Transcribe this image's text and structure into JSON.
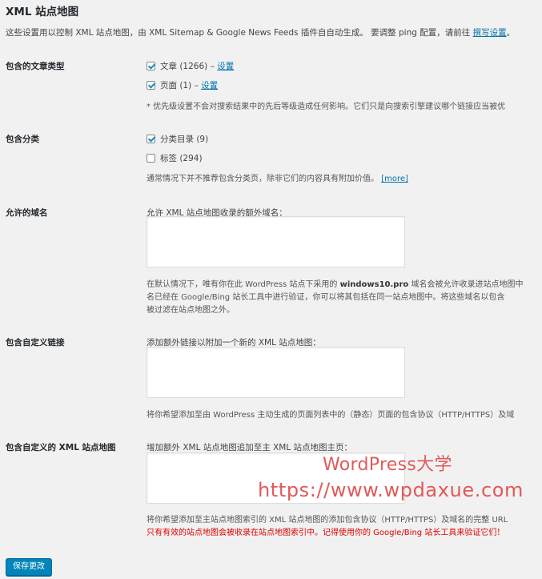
{
  "title": "XML 站点地图",
  "intro": {
    "text": "这些设置用以控制 XML 站点地图，由 XML Sitemap & Google News Feeds 插件自自动生成。 要调整 ping 配置，请前往",
    "link": "撰写设置",
    "end": "。"
  },
  "post_types": {
    "label": "包含的文章类型",
    "items": [
      {
        "label": "文章 (1266)",
        "sep": "–",
        "link": "设置",
        "checked": true
      },
      {
        "label": "页面 (1)",
        "sep": "–",
        "link": "设置",
        "checked": true
      }
    ],
    "note": "* 优先级设置不会对搜索结果中的先后等级造成任何影响。它们只是向搜索引擎建议哪个链接应当被优"
  },
  "taxonomies": {
    "label": "包含分类",
    "items": [
      {
        "label": "分类目录 (9)",
        "checked": true
      },
      {
        "label": "标签 (294)",
        "checked": false
      }
    ],
    "note": "通常情况下并不推荐包含分类页，除非它们的内容具有附加价值。",
    "more": "[more]"
  },
  "domains": {
    "label": "允许的域名",
    "field_label": "允许 XML 站点地图收录的额外域名：",
    "note_l1_a": "在默认情况下，唯有你在此 WordPress 站点下采用的",
    "note_l1_b": "windows10.pro",
    "note_l1_c": "域名会被允许收录进站点地图中",
    "note_l2": "名已经在 Google/Bing 站长工具中进行验证，你可以将其包括在同一站点地图中。将这些域名以包含",
    "note_l3": "被过滤在站点地图之外。"
  },
  "custom_urls": {
    "label": "包含自定义链接",
    "field_label": "添加额外链接以附加一个新的 XML 站点地图：",
    "note": "将你希望添加至由 WordPress 主动生成的页面列表中的（静态）页面的包含协议（HTTP/HTTPS）及域"
  },
  "custom_sitemaps": {
    "label": "包含自定义的 XML 站点地图",
    "field_label": "增加额外 XML 站点地图追加至主 XML 站点地图主页：",
    "note": "将你希望添加至主站点地图索引的 XML 站点地图的添加包含协议（HTTP/HTTPS）及域名的完整 URL",
    "warning": "只有有效的站点地图会被收录在站点地图索引中。记得使用你的 Google/Bing 站长工具来验证它们！"
  },
  "watermark": {
    "line1": "WordPress大学",
    "line2": "https://www.wpdaxue.com"
  },
  "save_button": "保存更改",
  "colors": {
    "accent": "#0073aa",
    "button": "#0085ba",
    "warning": "#dd0000",
    "background": "#f1f1f1"
  }
}
